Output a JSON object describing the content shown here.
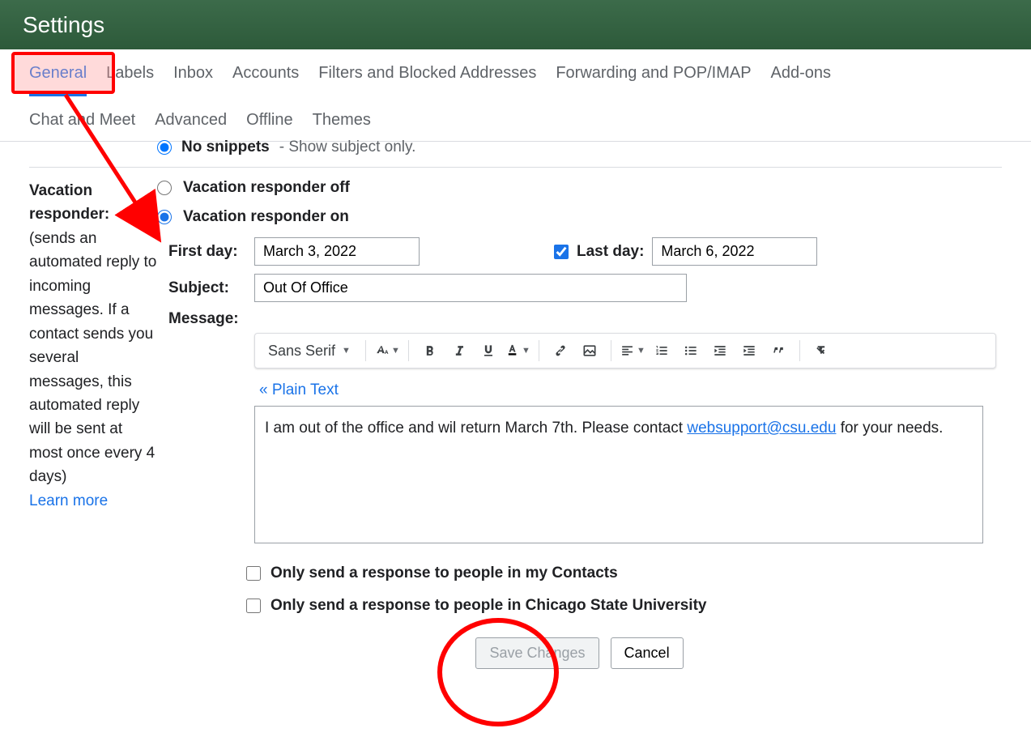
{
  "header": {
    "title": "Settings"
  },
  "tabs": {
    "row1": [
      "General",
      "Labels",
      "Inbox",
      "Accounts",
      "Filters and Blocked Addresses",
      "Forwarding and POP/IMAP",
      "Add-ons"
    ],
    "row2": [
      "Chat and Meet",
      "Advanced",
      "Offline",
      "Themes"
    ],
    "active": "General"
  },
  "snippet": {
    "label": "No snippets",
    "sub": "- Show subject only."
  },
  "vacation": {
    "title": "Vacation responder:",
    "desc": "(sends an automated reply to incoming messages. If a contact sends you several messages, this automated reply will be sent at most once every 4 days)",
    "learn": "Learn more",
    "off_label": "Vacation responder off",
    "on_label": "Vacation responder on",
    "first_day_label": "First day:",
    "first_day_value": "March 3, 2022",
    "last_day_label": "Last day:",
    "last_day_value": "March 6, 2022",
    "last_day_checked": true,
    "subject_label": "Subject:",
    "subject_value": "Out Of Office",
    "message_label": "Message:",
    "font_name": "Sans Serif",
    "plain_text": "« Plain Text",
    "body_pre": "I am out of the office and wil return March 7th. Please contact ",
    "body_link": "websupport@csu.edu",
    "body_post": " for your needs.",
    "only_contacts": "Only send a response to people in my Contacts",
    "only_org": "Only send a response to people in Chicago State University",
    "save": "Save Changes",
    "cancel": "Cancel"
  }
}
